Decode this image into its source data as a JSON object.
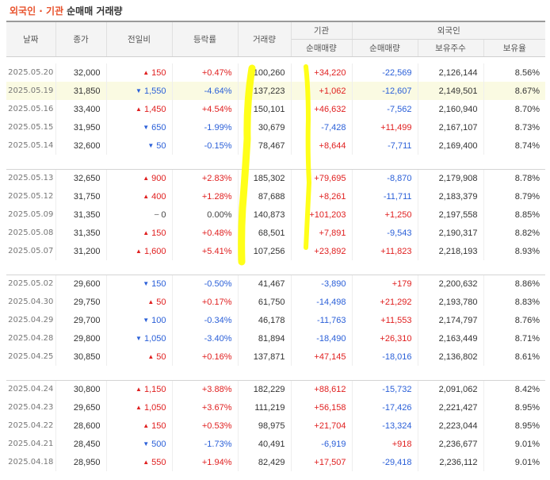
{
  "title": {
    "accent": "외국인 · 기관",
    "rest": "순매매 거래량"
  },
  "headers": {
    "date": "날짜",
    "close": "종가",
    "change": "전일비",
    "rate": "등락률",
    "volume": "거래량",
    "institution": "기관",
    "foreign": "외국인",
    "inst_net": "순매매량",
    "frgn_net": "순매매량",
    "frgn_holdings": "보유주수",
    "frgn_ratio": "보유율"
  },
  "colors": {
    "up": "#e02020",
    "down": "#2a5fd8",
    "accent": "#e8522c",
    "highlight": "#ffff00"
  },
  "rows": [
    {
      "date": "2025.05.20",
      "close": "32,000",
      "dir": "up",
      "change": "150",
      "rate": "+0.47%",
      "volume": "100,260",
      "inst": "+34,220",
      "frgn": "-22,569",
      "hold": "2,126,144",
      "ratio": "8.56%"
    },
    {
      "date": "2025.05.19",
      "close": "31,850",
      "dir": "down",
      "change": "1,550",
      "rate": "-4.64%",
      "volume": "137,223",
      "inst": "+1,062",
      "frgn": "-12,607",
      "hold": "2,149,501",
      "ratio": "8.67%"
    },
    {
      "date": "2025.05.16",
      "close": "33,400",
      "dir": "up",
      "change": "1,450",
      "rate": "+4.54%",
      "volume": "150,101",
      "inst": "+46,632",
      "frgn": "-7,562",
      "hold": "2,160,940",
      "ratio": "8.70%"
    },
    {
      "date": "2025.05.15",
      "close": "31,950",
      "dir": "down",
      "change": "650",
      "rate": "-1.99%",
      "volume": "30,679",
      "inst": "-7,428",
      "frgn": "+11,499",
      "hold": "2,167,107",
      "ratio": "8.73%"
    },
    {
      "date": "2025.05.14",
      "close": "32,600",
      "dir": "down",
      "change": "50",
      "rate": "-0.15%",
      "volume": "78,467",
      "inst": "+8,644",
      "frgn": "-7,711",
      "hold": "2,169,400",
      "ratio": "8.74%"
    },
    {
      "date": "2025.05.13",
      "close": "32,650",
      "dir": "up",
      "change": "900",
      "rate": "+2.83%",
      "volume": "185,302",
      "inst": "+79,695",
      "frgn": "-8,870",
      "hold": "2,179,908",
      "ratio": "8.78%"
    },
    {
      "date": "2025.05.12",
      "close": "31,750",
      "dir": "up",
      "change": "400",
      "rate": "+1.28%",
      "volume": "87,688",
      "inst": "+8,261",
      "frgn": "-11,711",
      "hold": "2,183,379",
      "ratio": "8.79%"
    },
    {
      "date": "2025.05.09",
      "close": "31,350",
      "dir": "flat",
      "change": "0",
      "rate": "0.00%",
      "volume": "140,873",
      "inst": "+101,203",
      "frgn": "+1,250",
      "hold": "2,197,558",
      "ratio": "8.85%"
    },
    {
      "date": "2025.05.08",
      "close": "31,350",
      "dir": "up",
      "change": "150",
      "rate": "+0.48%",
      "volume": "68,501",
      "inst": "+7,891",
      "frgn": "-9,543",
      "hold": "2,190,317",
      "ratio": "8.82%"
    },
    {
      "date": "2025.05.07",
      "close": "31,200",
      "dir": "up",
      "change": "1,600",
      "rate": "+5.41%",
      "volume": "107,256",
      "inst": "+23,892",
      "frgn": "+11,823",
      "hold": "2,218,193",
      "ratio": "8.93%"
    },
    {
      "date": "2025.05.02",
      "close": "29,600",
      "dir": "down",
      "change": "150",
      "rate": "-0.50%",
      "volume": "41,467",
      "inst": "-3,890",
      "frgn": "+179",
      "hold": "2,200,632",
      "ratio": "8.86%"
    },
    {
      "date": "2025.04.30",
      "close": "29,750",
      "dir": "up",
      "change": "50",
      "rate": "+0.17%",
      "volume": "61,750",
      "inst": "-14,498",
      "frgn": "+21,292",
      "hold": "2,193,780",
      "ratio": "8.83%"
    },
    {
      "date": "2025.04.29",
      "close": "29,700",
      "dir": "down",
      "change": "100",
      "rate": "-0.34%",
      "volume": "46,178",
      "inst": "-11,763",
      "frgn": "+11,553",
      "hold": "2,174,797",
      "ratio": "8.76%"
    },
    {
      "date": "2025.04.28",
      "close": "29,800",
      "dir": "down",
      "change": "1,050",
      "rate": "-3.40%",
      "volume": "81,894",
      "inst": "-18,490",
      "frgn": "+26,310",
      "hold": "2,163,449",
      "ratio": "8.71%"
    },
    {
      "date": "2025.04.25",
      "close": "30,850",
      "dir": "up",
      "change": "50",
      "rate": "+0.16%",
      "volume": "137,871",
      "inst": "+47,145",
      "frgn": "-18,016",
      "hold": "2,136,802",
      "ratio": "8.61%"
    },
    {
      "date": "2025.04.24",
      "close": "30,800",
      "dir": "up",
      "change": "1,150",
      "rate": "+3.88%",
      "volume": "182,229",
      "inst": "+88,612",
      "frgn": "-15,732",
      "hold": "2,091,062",
      "ratio": "8.42%"
    },
    {
      "date": "2025.04.23",
      "close": "29,650",
      "dir": "up",
      "change": "1,050",
      "rate": "+3.67%",
      "volume": "111,219",
      "inst": "+56,158",
      "frgn": "-17,426",
      "hold": "2,221,427",
      "ratio": "8.95%"
    },
    {
      "date": "2025.04.22",
      "close": "28,600",
      "dir": "up",
      "change": "150",
      "rate": "+0.53%",
      "volume": "98,975",
      "inst": "+21,704",
      "frgn": "-13,324",
      "hold": "2,223,044",
      "ratio": "8.95%"
    },
    {
      "date": "2025.04.21",
      "close": "28,450",
      "dir": "down",
      "change": "500",
      "rate": "-1.73%",
      "volume": "40,491",
      "inst": "-6,919",
      "frgn": "+918",
      "hold": "2,236,677",
      "ratio": "9.01%"
    },
    {
      "date": "2025.04.18",
      "close": "28,950",
      "dir": "up",
      "change": "550",
      "rate": "+1.94%",
      "volume": "82,429",
      "inst": "+17,507",
      "frgn": "-29,418",
      "hold": "2,236,112",
      "ratio": "9.01%"
    }
  ]
}
